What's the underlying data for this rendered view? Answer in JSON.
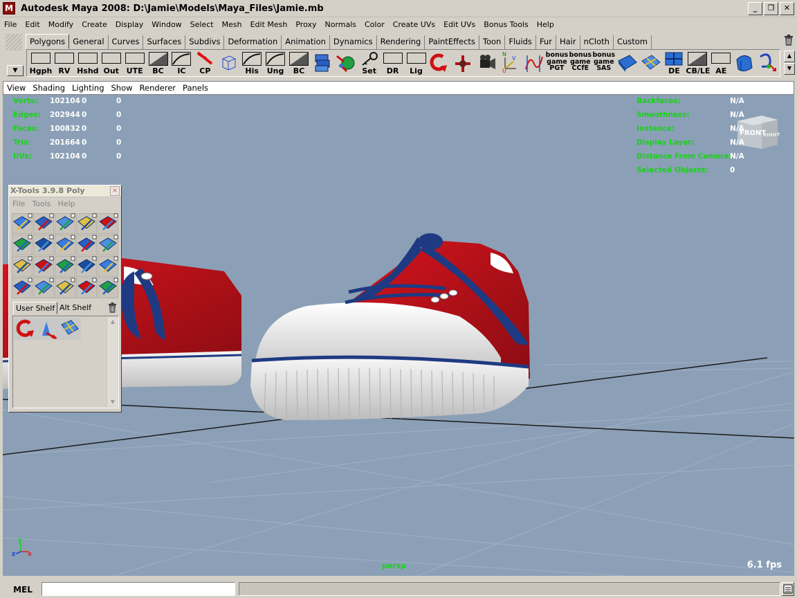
{
  "window": {
    "title": "Autodesk Maya 2008: D:\\Jamie\\Models\\Maya_Files\\Jamie.mb",
    "app_icon": "M",
    "controls": [
      "minimize-icon",
      "restore-icon",
      "close-icon"
    ]
  },
  "menubar": [
    "File",
    "Edit",
    "Modify",
    "Create",
    "Display",
    "Window",
    "Select",
    "Mesh",
    "Edit Mesh",
    "Proxy",
    "Normals",
    "Color",
    "Create UVs",
    "Edit UVs",
    "Bonus Tools",
    "Help"
  ],
  "shelf_tabs": {
    "active": "Polygons",
    "tabs": [
      "Polygons",
      "General",
      "Curves",
      "Surfaces",
      "Subdivs",
      "Deformation",
      "Animation",
      "Dynamics",
      "Rendering",
      "PaintEffects",
      "Toon",
      "Fluids",
      "Fur",
      "Hair",
      "nCloth",
      "Custom"
    ]
  },
  "shelf_icons": [
    {
      "label": "Hgph",
      "icon": "blank-box-icon"
    },
    {
      "label": "RV",
      "icon": "blank-box-icon"
    },
    {
      "label": "Hshd",
      "icon": "blank-box-icon"
    },
    {
      "label": "Out",
      "icon": "blank-box-icon"
    },
    {
      "label": "UTE",
      "icon": "blank-box-icon"
    },
    {
      "label": "BC",
      "icon": "diagonal-box-icon"
    },
    {
      "label": "IC",
      "icon": "curve-box-icon"
    },
    {
      "label": "CP",
      "icon": "red-arrow-icon"
    },
    {
      "label": "",
      "icon": "wire-cube-icon"
    },
    {
      "label": "His",
      "icon": "curve-box-icon"
    },
    {
      "label": "Ung",
      "icon": "curve-box-icon"
    },
    {
      "label": "BC",
      "icon": "diagonal-box-icon"
    },
    {
      "label": "",
      "icon": "blue-stack-icon"
    },
    {
      "label": "",
      "icon": "sphere-arrow-icon"
    },
    {
      "label": "Set",
      "icon": "key-icon"
    },
    {
      "label": "DR",
      "icon": "blank-box-icon"
    },
    {
      "label": "Lig",
      "icon": "blank-box-icon"
    },
    {
      "label": "",
      "icon": "red-arc-icon"
    },
    {
      "label": "",
      "icon": "red-joint-icon"
    },
    {
      "label": "",
      "icon": "camera-icon"
    },
    {
      "label": "",
      "icon": "nvu-axis-icon"
    },
    {
      "label": "",
      "icon": "red-curve-icon"
    },
    {
      "label": "bonus game PGT",
      "icon": "text-icon"
    },
    {
      "label": "bonus game CCfE",
      "icon": "text-icon"
    },
    {
      "label": "bonus game SAS",
      "icon": "text-icon"
    },
    {
      "label": "",
      "icon": "blue-plane-icon"
    },
    {
      "label": "",
      "icon": "uv-grid-icon"
    },
    {
      "label": "DE",
      "icon": "uv-blue-icon"
    },
    {
      "label": "CB/LE",
      "icon": "diagonal-box-icon"
    },
    {
      "label": "AE",
      "icon": "blank-box-icon"
    },
    {
      "label": "",
      "icon": "blue-shape-icon"
    },
    {
      "label": "",
      "icon": "curve-select-icon"
    }
  ],
  "panel_menu": [
    "View",
    "Shading",
    "Lighting",
    "Show",
    "Renderer",
    "Panels"
  ],
  "hud_left": {
    "labels": [
      "Verts:",
      "Edges:",
      "Faces:",
      "Tris:",
      "UVs:"
    ],
    "rows": [
      [
        "102104",
        "0",
        "0"
      ],
      [
        "202944",
        "0",
        "0"
      ],
      [
        "100832",
        "0",
        "0"
      ],
      [
        "201664",
        "0",
        "0"
      ],
      [
        "102104",
        "0",
        "0"
      ]
    ]
  },
  "hud_right": {
    "labels": [
      "Backfaces:",
      "Smoothness:",
      "Instance:",
      "Display Layer:",
      "Distance From Camera:",
      "Selected Objects:"
    ],
    "values": [
      "N/A",
      "N/A",
      "N/A",
      "N/A",
      "N/A",
      "0"
    ]
  },
  "viewcube": {
    "front": "FRONT",
    "right": "RIGHT"
  },
  "axis": {
    "y": "y",
    "z": "z",
    "x": "x"
  },
  "camera_name": "persp",
  "fps": "6.1 fps",
  "xtools": {
    "title": "X-Tools 3.9.8 Poly",
    "close": "×",
    "menu": [
      "File",
      "Tools",
      "Help"
    ],
    "shelf_tabs": [
      "User Shelf",
      "Alt Shelf"
    ],
    "active_tab": "User Shelf"
  },
  "command_line": {
    "label": "MEL",
    "value": ""
  },
  "colors": {
    "viewport_bg": "#8ba0b6",
    "hud_green": "#19d119",
    "shoe_red": "#b8101a",
    "lace_blue": "#1e3a82",
    "ui_gray": "#d4d0c8"
  }
}
